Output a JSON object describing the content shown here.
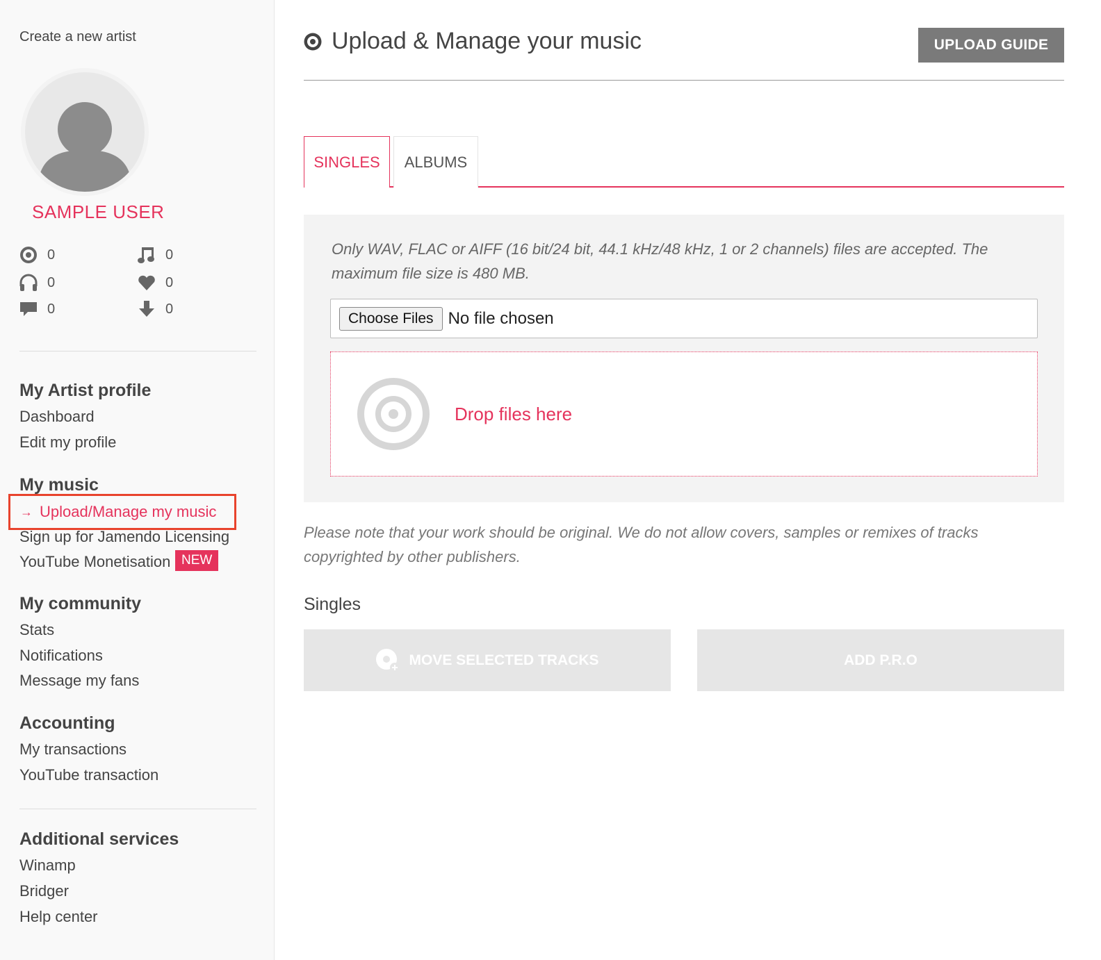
{
  "sidebar": {
    "create_artist": "Create a new artist",
    "username": "SAMPLE USER",
    "stats": {
      "albums": "0",
      "tracks": "0",
      "listens": "0",
      "favorites": "0",
      "comments": "0",
      "downloads": "0"
    },
    "sections": {
      "artist_profile": {
        "title": "My Artist profile",
        "items": [
          "Dashboard",
          "Edit my profile"
        ]
      },
      "music": {
        "title": "My music",
        "active_item": "Upload/Manage my music",
        "active_arrow": "→",
        "items": [
          "Sign up for Jamendo Licensing",
          "YouTube Monetisation"
        ],
        "badge": "NEW"
      },
      "community": {
        "title": "My community",
        "items": [
          "Stats",
          "Notifications",
          "Message my fans"
        ]
      },
      "accounting": {
        "title": "Accounting",
        "items": [
          "My transactions",
          "YouTube transaction"
        ]
      },
      "additional": {
        "title": "Additional services",
        "items": [
          "Winamp",
          "Bridger",
          "Help center"
        ]
      }
    }
  },
  "main": {
    "title": "Upload & Manage your music",
    "upload_guide": "UPLOAD GUIDE",
    "tabs": [
      "SINGLES",
      "ALBUMS"
    ],
    "active_tab": "SINGLES",
    "upload_note": "Only WAV, FLAC or AIFF (16 bit/24 bit, 44.1 kHz/48 kHz, 1 or 2 channels) files are accepted. The maximum file size is 480 MB.",
    "choose_files": "Choose Files",
    "no_file": "No file chosen",
    "drop_text": "Drop files here",
    "original_note": "Please note that your work should be original. We do not allow covers, samples or remixes of tracks copyrighted by other publishers.",
    "singles_heading": "Singles",
    "move_tracks": "MOVE SELECTED TRACKS",
    "add_pro": "ADD P.R.O"
  },
  "colors": {
    "accent": "#e5335c",
    "highlight_border": "#e8432d",
    "guide_button": "#7a7a7a",
    "disabled_button": "#e6e6e6"
  }
}
